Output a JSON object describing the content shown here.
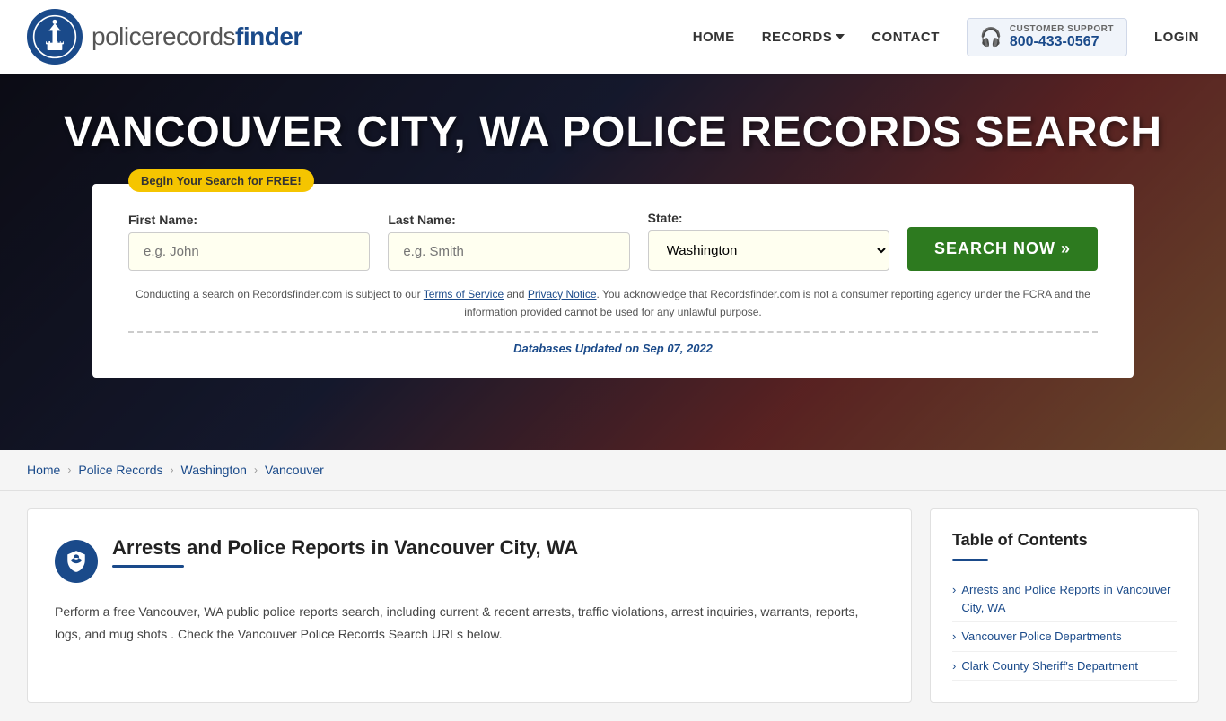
{
  "header": {
    "logo_text_police": "policerecords",
    "logo_text_finder": "finder",
    "nav": {
      "home": "HOME",
      "records": "RECORDS",
      "contact": "CONTACT",
      "support_label": "CUSTOMER SUPPORT",
      "support_number": "800-433-0567",
      "login": "LOGIN"
    }
  },
  "hero": {
    "title": "VANCOUVER CITY, WA POLICE RECORDS SEARCH"
  },
  "search": {
    "badge": "Begin Your Search for FREE!",
    "first_name_label": "First Name:",
    "first_name_placeholder": "e.g. John",
    "last_name_label": "Last Name:",
    "last_name_placeholder": "e.g. Smith",
    "state_label": "State:",
    "state_value": "Washington",
    "button": "SEARCH NOW »",
    "disclaimer": "Conducting a search on Recordsfinder.com is subject to our Terms of Service and Privacy Notice. You acknowledge that Recordsfinder.com is not a consumer reporting agency under the FCRA and the information provided cannot be used for any unlawful purpose.",
    "terms_link": "Terms of Service",
    "privacy_link": "Privacy Notice",
    "db_updated_prefix": "Databases Updated on",
    "db_updated_date": "Sep 07, 2022"
  },
  "breadcrumb": {
    "home": "Home",
    "police_records": "Police Records",
    "washington": "Washington",
    "vancouver": "Vancouver"
  },
  "main": {
    "article_title": "Arrests and Police Reports in Vancouver City, WA",
    "article_body": "Perform a free Vancouver, WA public police reports search, including current & recent arrests, traffic violations, arrest inquiries, warrants, reports, logs, and mug shots . Check the Vancouver Police Records Search URLs below."
  },
  "toc": {
    "title": "Table of Contents",
    "items": [
      "Arrests and Police Reports in Vancouver City, WA",
      "Vancouver Police Departments",
      "Clark County Sheriff's Department"
    ]
  }
}
